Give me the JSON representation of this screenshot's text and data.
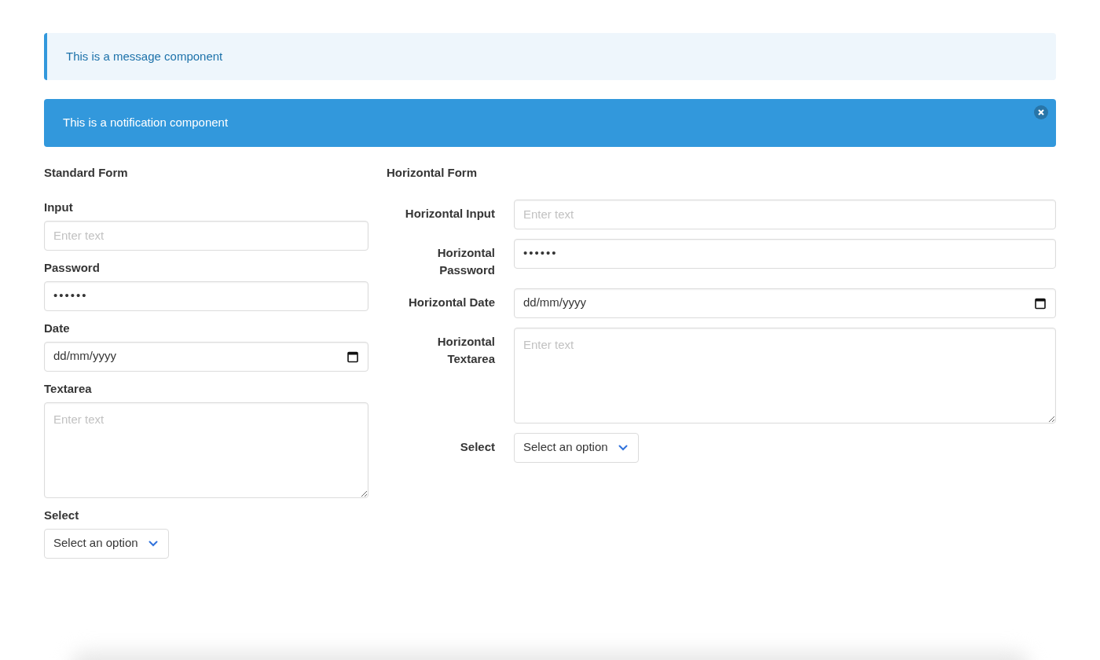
{
  "message": {
    "text": "This is a message component"
  },
  "notification": {
    "text": "This is a notification component"
  },
  "standard_form": {
    "title": "Standard Form",
    "fields": [
      {
        "kind": "text",
        "label": "Input",
        "placeholder": "Enter text"
      },
      {
        "kind": "password",
        "label": "Password",
        "value": "••••••"
      },
      {
        "kind": "date",
        "label": "Date",
        "value": "dd/mm/yyyy"
      },
      {
        "kind": "textarea",
        "label": "Textarea",
        "placeholder": "Enter text"
      },
      {
        "kind": "select",
        "label": "Select",
        "value": "Select an option"
      }
    ]
  },
  "horizontal_form": {
    "title": "Horizontal Form",
    "fields": [
      {
        "kind": "text",
        "label": "Horizontal Input",
        "placeholder": "Enter text"
      },
      {
        "kind": "password",
        "label": "Horizontal Password",
        "value": "••••••"
      },
      {
        "kind": "date",
        "label": "Horizontal Date",
        "value": "dd/mm/yyyy"
      },
      {
        "kind": "textarea",
        "label": "Horizontal Textarea",
        "placeholder": "Enter text"
      },
      {
        "kind": "select",
        "label": "Select",
        "value": "Select an option"
      }
    ]
  }
}
